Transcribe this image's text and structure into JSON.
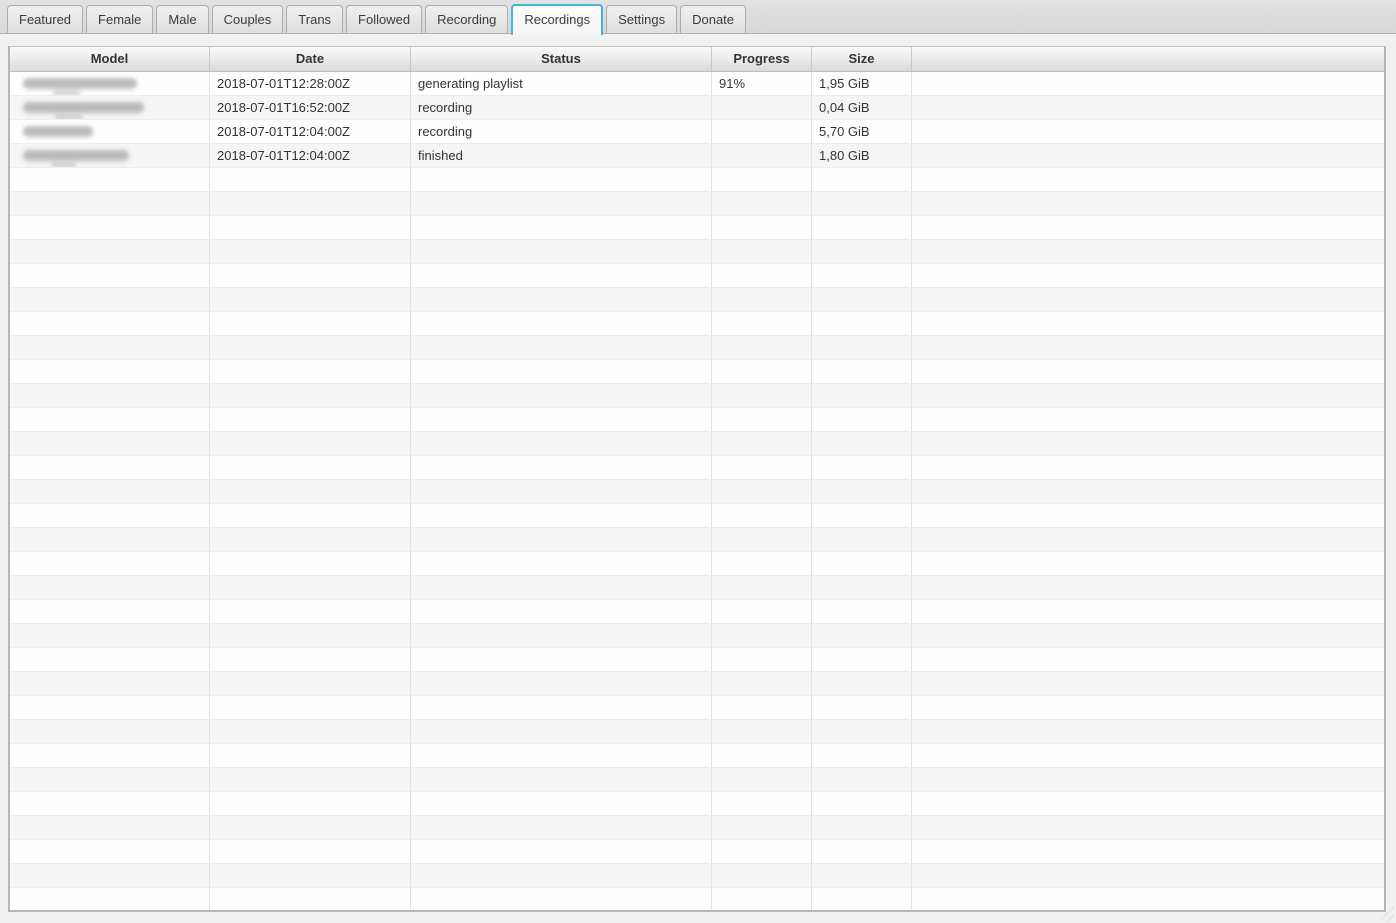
{
  "tabs": [
    {
      "label": "Featured",
      "selected": false
    },
    {
      "label": "Female",
      "selected": false
    },
    {
      "label": "Male",
      "selected": false
    },
    {
      "label": "Couples",
      "selected": false
    },
    {
      "label": "Trans",
      "selected": false
    },
    {
      "label": "Followed",
      "selected": false
    },
    {
      "label": "Recording",
      "selected": false
    },
    {
      "label": "Recordings",
      "selected": true
    },
    {
      "label": "Settings",
      "selected": false
    },
    {
      "label": "Donate",
      "selected": false
    }
  ],
  "table": {
    "columns": [
      {
        "label": "Model"
      },
      {
        "label": "Date"
      },
      {
        "label": "Status"
      },
      {
        "label": "Progress"
      },
      {
        "label": "Size"
      },
      {
        "label": ""
      }
    ],
    "rows": [
      {
        "model_redacted": true,
        "blur_width": 114,
        "tail": true,
        "date": "2018-07-01T12:28:00Z",
        "status": "generating playlist",
        "progress": "91%",
        "size": "1,95 GiB"
      },
      {
        "model_redacted": true,
        "blur_width": 121,
        "tail": true,
        "date": "2018-07-01T16:52:00Z",
        "status": "recording",
        "progress": "",
        "size": "0,04 GiB"
      },
      {
        "model_redacted": true,
        "blur_width": 70,
        "tail": false,
        "date": "2018-07-01T12:04:00Z",
        "status": "recording",
        "progress": "",
        "size": "5,70 GiB"
      },
      {
        "model_redacted": true,
        "blur_width": 106,
        "tail": true,
        "date": "2018-07-01T12:04:00Z",
        "status": "finished",
        "progress": "",
        "size": "1,80 GiB"
      }
    ],
    "empty_rows": 31
  },
  "colors": {
    "selected_tab_border": "#4ab3d9",
    "row_stripe": "#f5f5f5",
    "text": "#333333"
  }
}
